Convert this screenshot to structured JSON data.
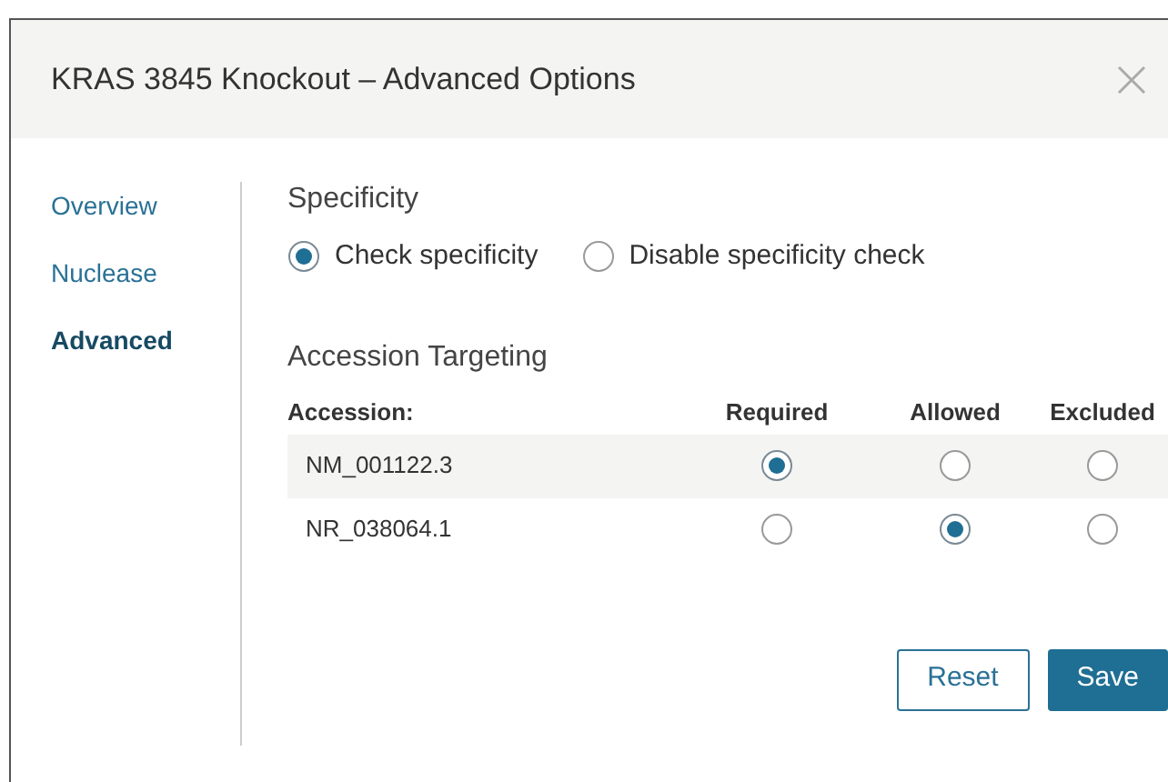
{
  "dialog": {
    "title": "KRAS 3845 Knockout – Advanced Options"
  },
  "sidebar": {
    "items": [
      {
        "label": "Overview",
        "selected": false
      },
      {
        "label": "Nuclease",
        "selected": false
      },
      {
        "label": "Advanced",
        "selected": true
      }
    ]
  },
  "specificity": {
    "heading": "Specificity",
    "options": [
      {
        "label": "Check specificity",
        "selected": true
      },
      {
        "label": "Disable specificity check",
        "selected": false
      }
    ]
  },
  "accession_targeting": {
    "heading": "Accession Targeting",
    "columns": [
      "Accession:",
      "Required",
      "Allowed",
      "Excluded"
    ],
    "rows": [
      {
        "accession": "NM_001122.3",
        "choices": [
          {
            "selected": true
          },
          {
            "selected": false
          },
          {
            "selected": false
          }
        ]
      },
      {
        "accession": "NR_038064.1",
        "choices": [
          {
            "selected": false
          },
          {
            "selected": true
          },
          {
            "selected": false
          }
        ]
      }
    ]
  },
  "buttons": [
    {
      "label": "Reset",
      "kind": "secondary"
    },
    {
      "label": "Save",
      "kind": "primary"
    }
  ]
}
